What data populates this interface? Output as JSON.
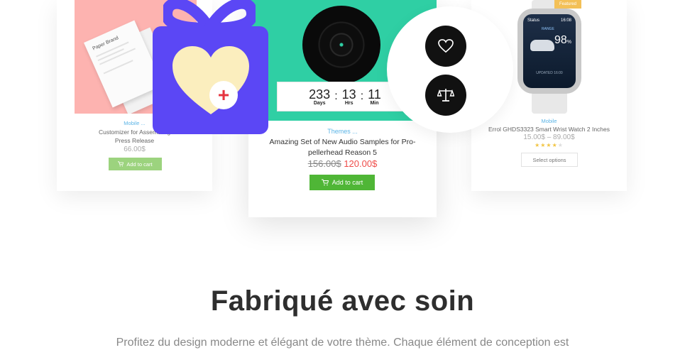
{
  "cards": {
    "left": {
      "image_text": "Paper Brand",
      "category": "Mobile ...",
      "title": "Customizer for Assembling ... Press Release",
      "title_line1": "Customizer for Assembling",
      "title_line2": "Press Release",
      "price": "66.00$",
      "button": "Add to cart"
    },
    "middle": {
      "countdown": [
        {
          "value": "233",
          "label": "Days"
        },
        {
          "value": "13",
          "label": "Hrs"
        },
        {
          "value": "11",
          "label": "Min"
        }
      ],
      "category": "Themes ...",
      "title_line1": "Amazing Set of New Audio Samples for Pro-",
      "title_line2": "pellerhead Reason 5",
      "old_price": "156.00$",
      "new_price": "120.00$",
      "button": "Add to cart"
    },
    "right": {
      "badge": "Featured",
      "watch_status": "Status",
      "watch_time": "16:08",
      "watch_range": "RANGE",
      "watch_percent": "98",
      "watch_unit": "%",
      "watch_updated": "UPDATED 16:00",
      "category": "Mobile",
      "title": "Errol GHDS3323 Smart Wrist Watch 2 Inches",
      "price": "15.00$ – 89.00$",
      "rating_filled": 4,
      "rating_total": 5,
      "button": "Select options"
    }
  },
  "overlay": {
    "gift_icon": "gift-heart-icon",
    "plus_icon": "plus-icon",
    "wishlist_icon": "heart-icon",
    "compare_icon": "scale-icon"
  },
  "section": {
    "heading": "Fabriqué avec soin",
    "paragraph": "Profitez du design moderne et élégant de votre thème. Chaque élément de conception est"
  },
  "colors": {
    "accent_purple": "#5b47f5",
    "teal": "#2fcfa4",
    "pink": "#fdb3b0",
    "add_to_cart_green": "#4fb636",
    "sale_red": "#ef4c49"
  }
}
